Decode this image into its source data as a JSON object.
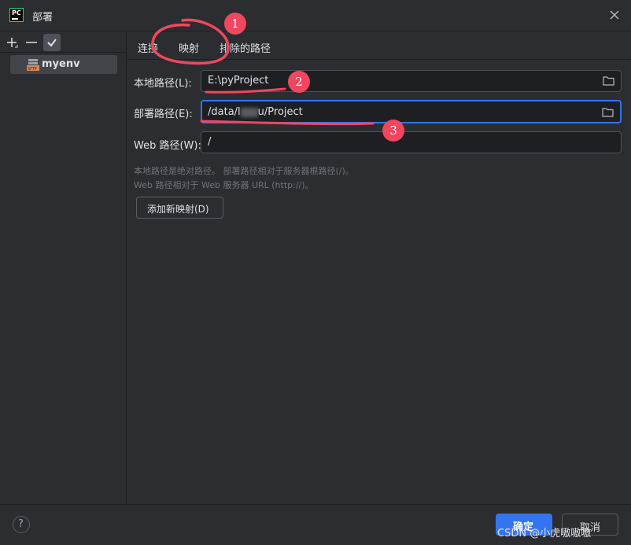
{
  "window": {
    "title": "部署"
  },
  "app_icon": {
    "text": "PC"
  },
  "left_panel": {
    "items": [
      {
        "label": "myenv",
        "icon": "sftp-server-icon"
      }
    ]
  },
  "tabs": [
    {
      "label": "连接"
    },
    {
      "label": "映射"
    },
    {
      "label": "排除的路径"
    }
  ],
  "form": {
    "local_path": {
      "label": "本地路径(L):",
      "value": "E:\\pyProject"
    },
    "deploy_path": {
      "label": "部署路径(E):",
      "value_prefix": "/data/l",
      "value_suffix": "u/Project"
    },
    "web_path": {
      "label": "Web 路径(W):",
      "value": "/"
    }
  },
  "hints": {
    "line1": "本地路径是绝对路径。 部署路径相对于服务器根路径(/)。",
    "line2": "Web 路径相对于 Web 服务器 URL (http://)。"
  },
  "buttons": {
    "add_mapping": "添加新映射(D)",
    "help": "?",
    "ok": "确定",
    "cancel": "取消"
  },
  "annotations": {
    "badges": [
      "1",
      "2",
      "3"
    ],
    "color": "#f0475f"
  },
  "watermark": "CSDN @小虎嗷嗷嗷",
  "colors": {
    "accent": "#3574f0",
    "background": "#2b2d30",
    "field_bg": "#1e1f22"
  }
}
